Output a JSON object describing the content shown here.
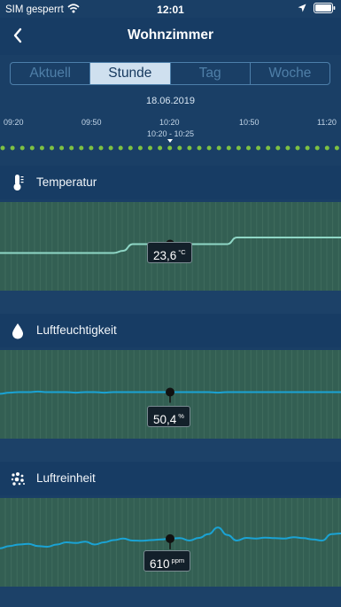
{
  "status": {
    "carrier": "SIM gesperrt",
    "time": "12:01"
  },
  "nav": {
    "title": "Wohnzimmer"
  },
  "tabs": [
    {
      "label": "Aktuell",
      "active": false
    },
    {
      "label": "Stunde",
      "active": true
    },
    {
      "label": "Tag",
      "active": false
    },
    {
      "label": "Woche",
      "active": false
    }
  ],
  "date": "18.06.2019",
  "timeline": {
    "labels": [
      "09:20",
      "09:50",
      "10:20",
      "10:50",
      "11:20"
    ],
    "selected_range": "10:20 - 10:25"
  },
  "sections": [
    {
      "title": "Temperatur",
      "icon": "thermometer-icon",
      "value": "23,6",
      "unit": "°C",
      "line_color": "#8fd7c6",
      "series": [
        23.2,
        23.2,
        23.2,
        23.2,
        23.2,
        23.2,
        23.2,
        23.2,
        23.2,
        23.2,
        23.2,
        23.2,
        23.2,
        23.3,
        23.6,
        23.6,
        23.6,
        23.6,
        23.6,
        23.6,
        23.6,
        23.6,
        23.6,
        23.6,
        23.6,
        23.9,
        23.9,
        23.9,
        23.9,
        23.9,
        23.9,
        23.9,
        23.9,
        23.9,
        23.9,
        23.9,
        23.9
      ],
      "range": [
        21.5,
        25.5
      ]
    },
    {
      "title": "Luftfeuchtigkeit",
      "icon": "droplet-icon",
      "value": "50,4",
      "unit": "%",
      "line_color": "#1aa3d4",
      "series": [
        50.1,
        50.3,
        50.4,
        50.4,
        50.5,
        50.4,
        50.4,
        50.4,
        50.3,
        50.4,
        50.4,
        50.3,
        50.4,
        50.4,
        50.4,
        50.4,
        50.4,
        50.4,
        50.4,
        50.4,
        50.4,
        50.4,
        50.4,
        50.3,
        50.4,
        50.4,
        50.4,
        50.4,
        50.4,
        50.4,
        50.4,
        50.4,
        50.4,
        50.4,
        50.4,
        50.4,
        50.4
      ],
      "range": [
        42,
        58
      ]
    },
    {
      "title": "Luftreinheit",
      "icon": "particles-icon",
      "value": "610",
      "unit": "ppm",
      "line_color": "#1aa3d4",
      "series": [
        560,
        575,
        585,
        590,
        575,
        570,
        585,
        600,
        595,
        605,
        585,
        600,
        615,
        625,
        612,
        610,
        615,
        620,
        625,
        628,
        612,
        630,
        655,
        700,
        650,
        612,
        630,
        625,
        632,
        628,
        625,
        635,
        628,
        620,
        612,
        655,
        660
      ],
      "range": [
        300,
        900
      ]
    }
  ]
}
